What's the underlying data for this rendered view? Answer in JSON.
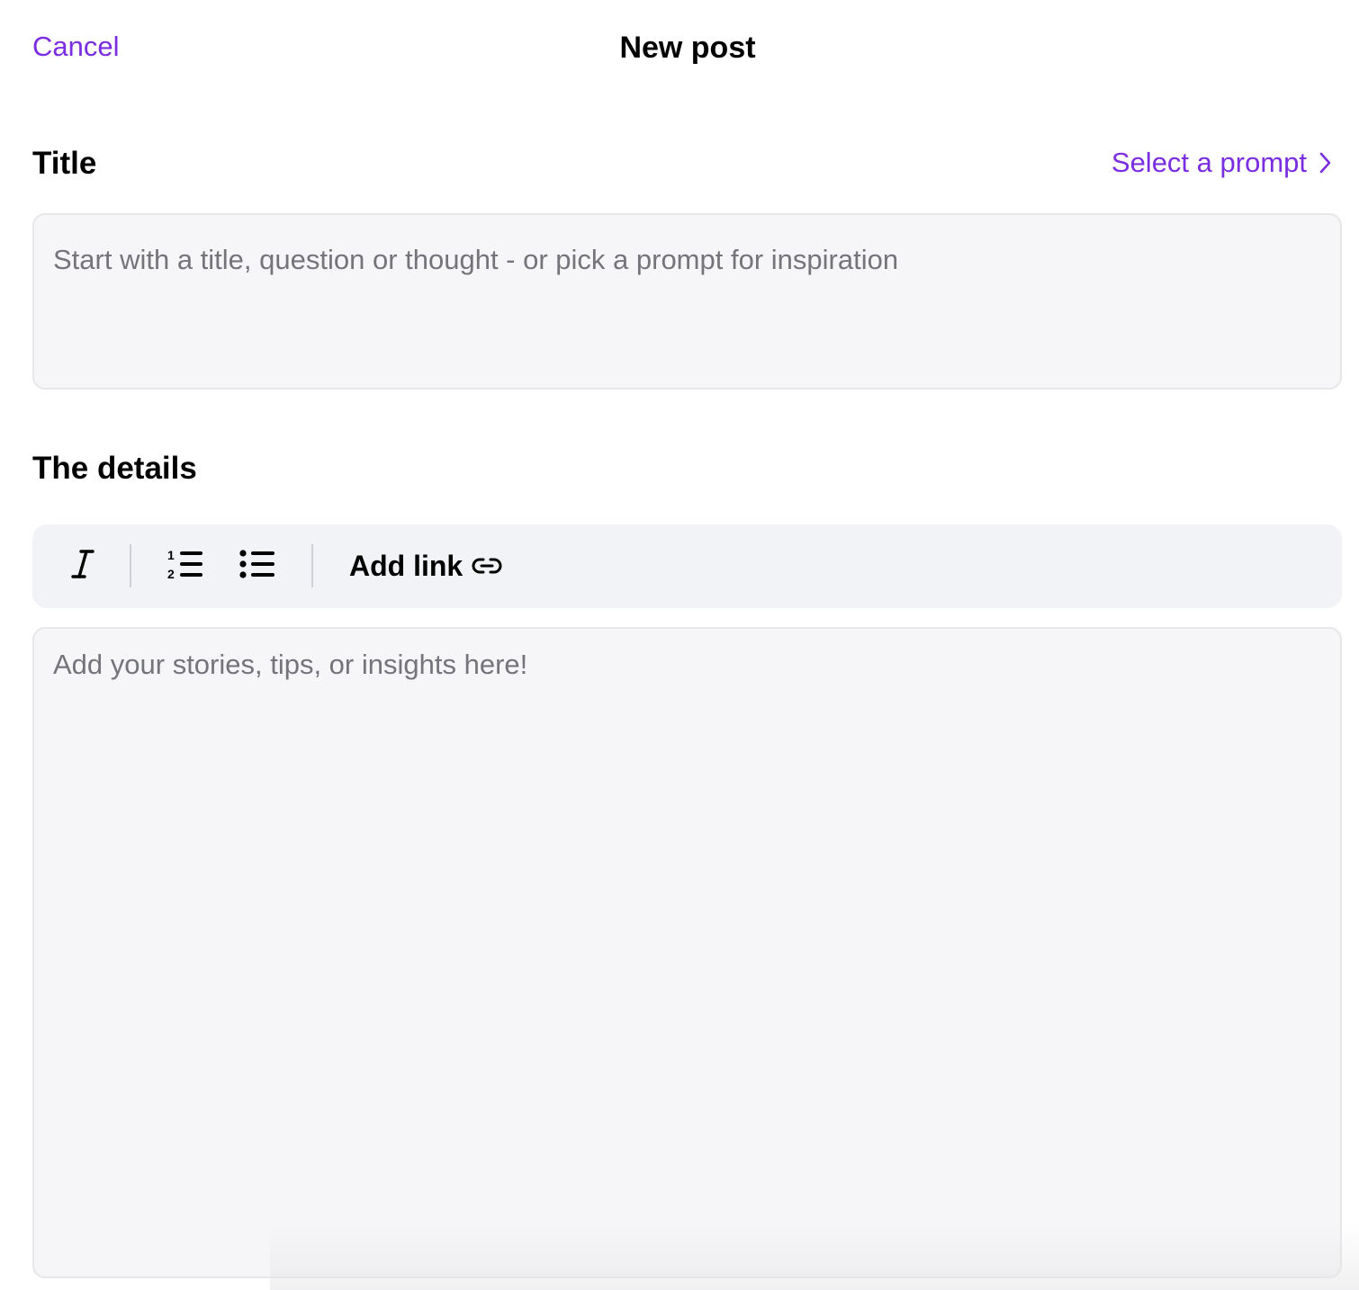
{
  "header": {
    "cancel_label": "Cancel",
    "title": "New post"
  },
  "title_section": {
    "label": "Title",
    "prompt_link_label": "Select a prompt",
    "prompt_link_icon": "chevron-right-icon",
    "input_value": "",
    "input_placeholder": "Start with a title, question or thought - or pick a prompt for inspiration"
  },
  "details_section": {
    "label": "The details",
    "toolbar": {
      "italic_icon": "italic-icon",
      "numbered_list_icon": "numbered-list-icon",
      "bulleted_list_icon": "bulleted-list-icon",
      "add_link_label": "Add link",
      "add_link_icon": "link-icon"
    },
    "input_value": "",
    "input_placeholder": "Add your stories, tips, or insights here!"
  },
  "colors": {
    "accent": "#7a2ee0",
    "input_background": "#f6f6f8",
    "toolbar_background": "#f2f3f7",
    "placeholder": "#74747b"
  }
}
